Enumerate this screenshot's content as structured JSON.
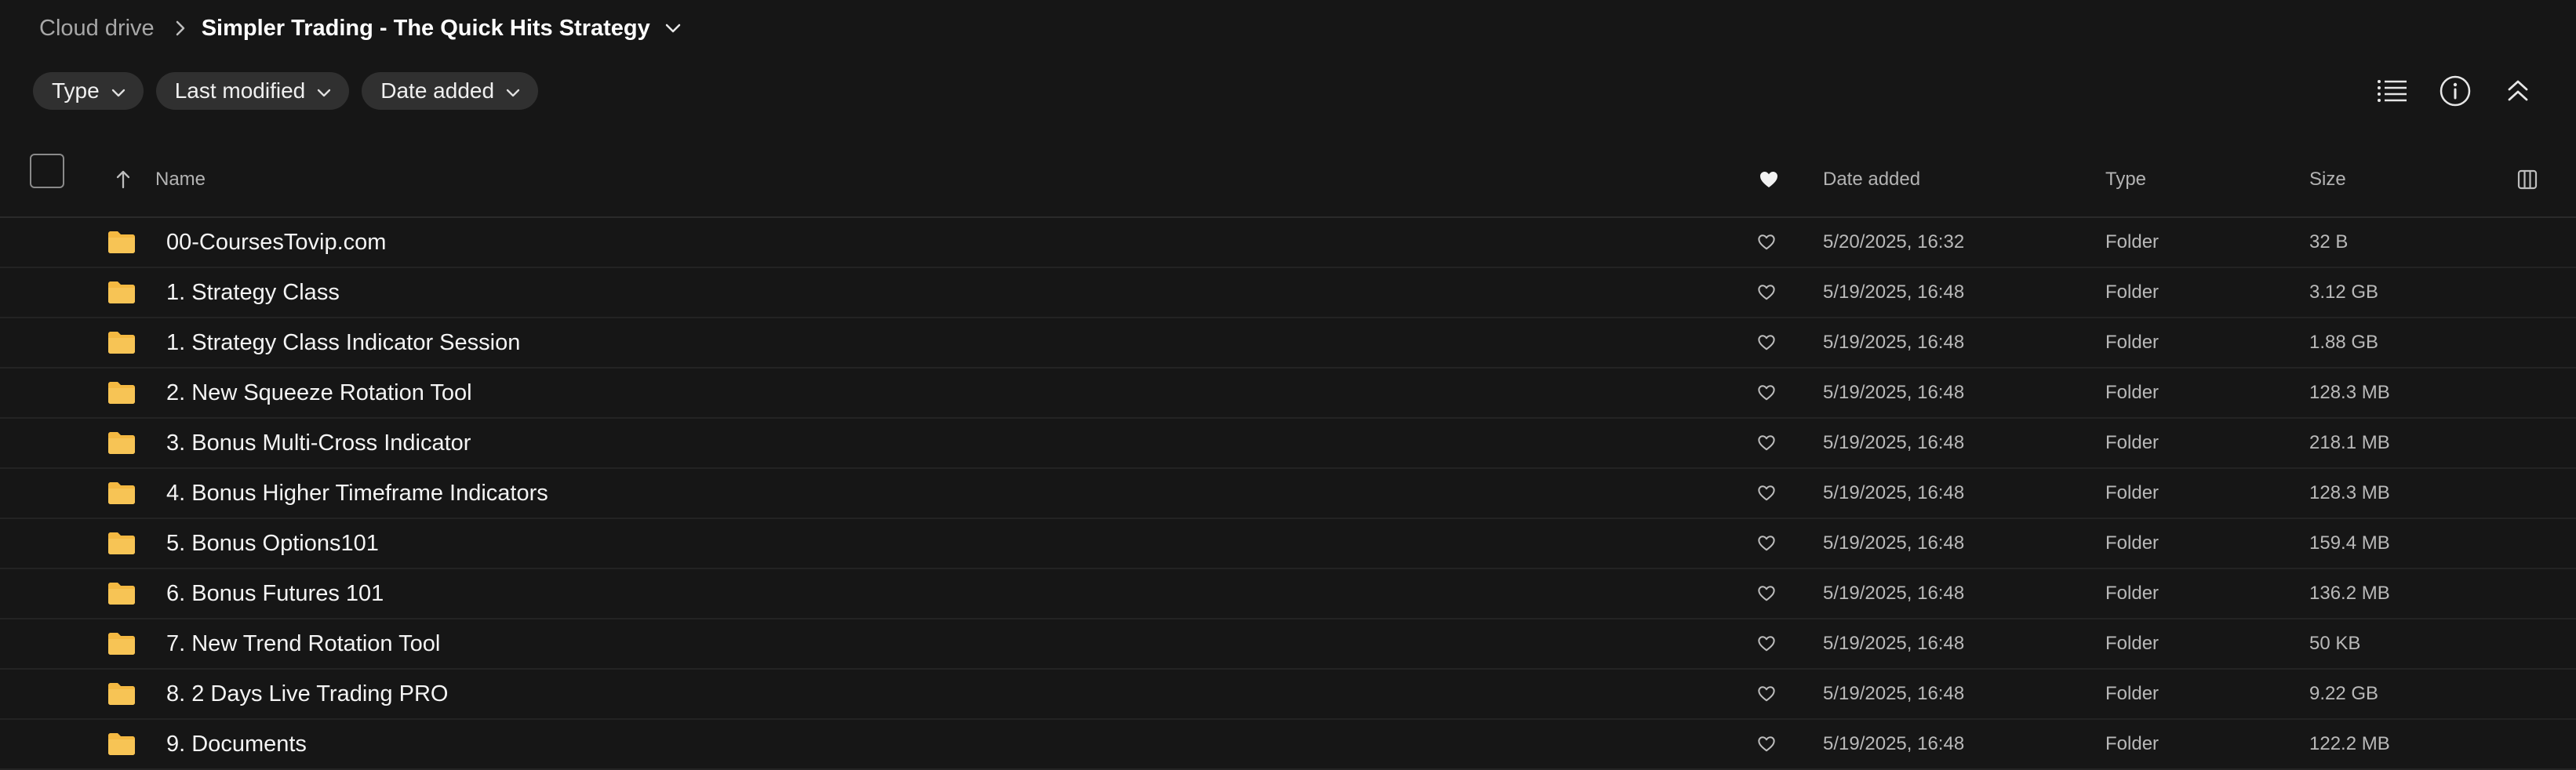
{
  "breadcrumb": {
    "root": "Cloud drive",
    "current": "Simpler Trading - The Quick Hits Strategy"
  },
  "filters": [
    {
      "label": "Type"
    },
    {
      "label": "Last modified"
    },
    {
      "label": "Date added"
    }
  ],
  "toolbar": {
    "icons": [
      "list-view-icon",
      "info-icon",
      "collapse-icon"
    ]
  },
  "table": {
    "columns": {
      "name": "Name",
      "date_added": "Date added",
      "type": "Type",
      "size": "Size"
    },
    "rows": [
      {
        "name": "00-CoursesTovip.com",
        "date": "5/20/2025, 16:32",
        "type": "Folder",
        "size": "32 B"
      },
      {
        "name": "1. Strategy Class",
        "date": "5/19/2025, 16:48",
        "type": "Folder",
        "size": "3.12 GB"
      },
      {
        "name": "1. Strategy Class Indicator Session",
        "date": "5/19/2025, 16:48",
        "type": "Folder",
        "size": "1.88 GB"
      },
      {
        "name": "2. New Squeeze Rotation Tool",
        "date": "5/19/2025, 16:48",
        "type": "Folder",
        "size": "128.3 MB"
      },
      {
        "name": "3. Bonus Multi-Cross Indicator",
        "date": "5/19/2025, 16:48",
        "type": "Folder",
        "size": "218.1 MB"
      },
      {
        "name": "4. Bonus Higher Timeframe Indicators",
        "date": "5/19/2025, 16:48",
        "type": "Folder",
        "size": "128.3 MB"
      },
      {
        "name": "5. Bonus Options101",
        "date": "5/19/2025, 16:48",
        "type": "Folder",
        "size": "159.4 MB"
      },
      {
        "name": "6. Bonus Futures 101",
        "date": "5/19/2025, 16:48",
        "type": "Folder",
        "size": "136.2 MB"
      },
      {
        "name": "7. New Trend Rotation Tool",
        "date": "5/19/2025, 16:48",
        "type": "Folder",
        "size": "50 KB"
      },
      {
        "name": "8. 2 Days Live Trading PRO",
        "date": "5/19/2025, 16:48",
        "type": "Folder",
        "size": "9.22 GB"
      },
      {
        "name": "9. Documents",
        "date": "5/19/2025, 16:48",
        "type": "Folder",
        "size": "122.2 MB"
      }
    ]
  },
  "colors": {
    "background": "#161616",
    "chip": "#303030",
    "folder": "#f4b942"
  }
}
